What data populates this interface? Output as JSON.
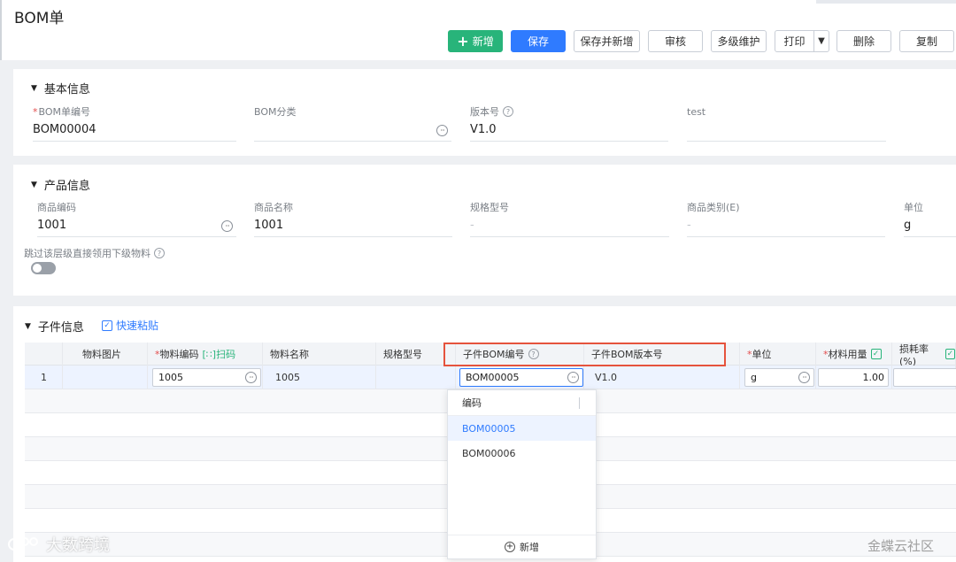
{
  "header": {
    "title": "BOM单"
  },
  "toolbar": {
    "add": "新增",
    "save": "保存",
    "save_new": "保存并新增",
    "audit": "审核",
    "multi": "多级维护",
    "print": "打印",
    "delete": "删除",
    "copy": "复制"
  },
  "basic": {
    "title": "基本信息",
    "bom_no_label": "BOM单编号",
    "bom_no": "BOM00004",
    "bom_cat_label": "BOM分类",
    "bom_cat": "",
    "version_label": "版本号",
    "version": "V1.0",
    "test_label": "test",
    "test": ""
  },
  "product": {
    "title": "产品信息",
    "code_label": "商品编码",
    "code": "1001",
    "name_label": "商品名称",
    "name": "1001",
    "spec_label": "规格型号",
    "spec": "-",
    "cat_label": "商品类别(E)",
    "cat": "-",
    "unit_label": "单位",
    "unit": "g",
    "skip_label": "跳过该层级直接领用下级物料"
  },
  "children": {
    "title": "子件信息",
    "quick_paste": "快速粘贴",
    "headers": {
      "image": "物料图片",
      "code": "物料编码",
      "scan": "扫码",
      "name": "物料名称",
      "spec": "规格型号",
      "child_bom": "子件BOM编号",
      "child_ver": "子件BOM版本号",
      "unit": "单位",
      "qty": "材料用量",
      "loss": "损耗率(%)"
    },
    "row": {
      "index": "1",
      "code": "1005",
      "name": "1005",
      "child_bom": "BOM00005",
      "child_ver": "V1.0",
      "unit": "g",
      "qty": "1.00"
    }
  },
  "dropdown": {
    "header": "编码",
    "items": [
      "BOM00005",
      "BOM00006"
    ],
    "footer": "新增"
  },
  "watermark": {
    "left": "大数跨境",
    "right": "金蝶云社区"
  }
}
